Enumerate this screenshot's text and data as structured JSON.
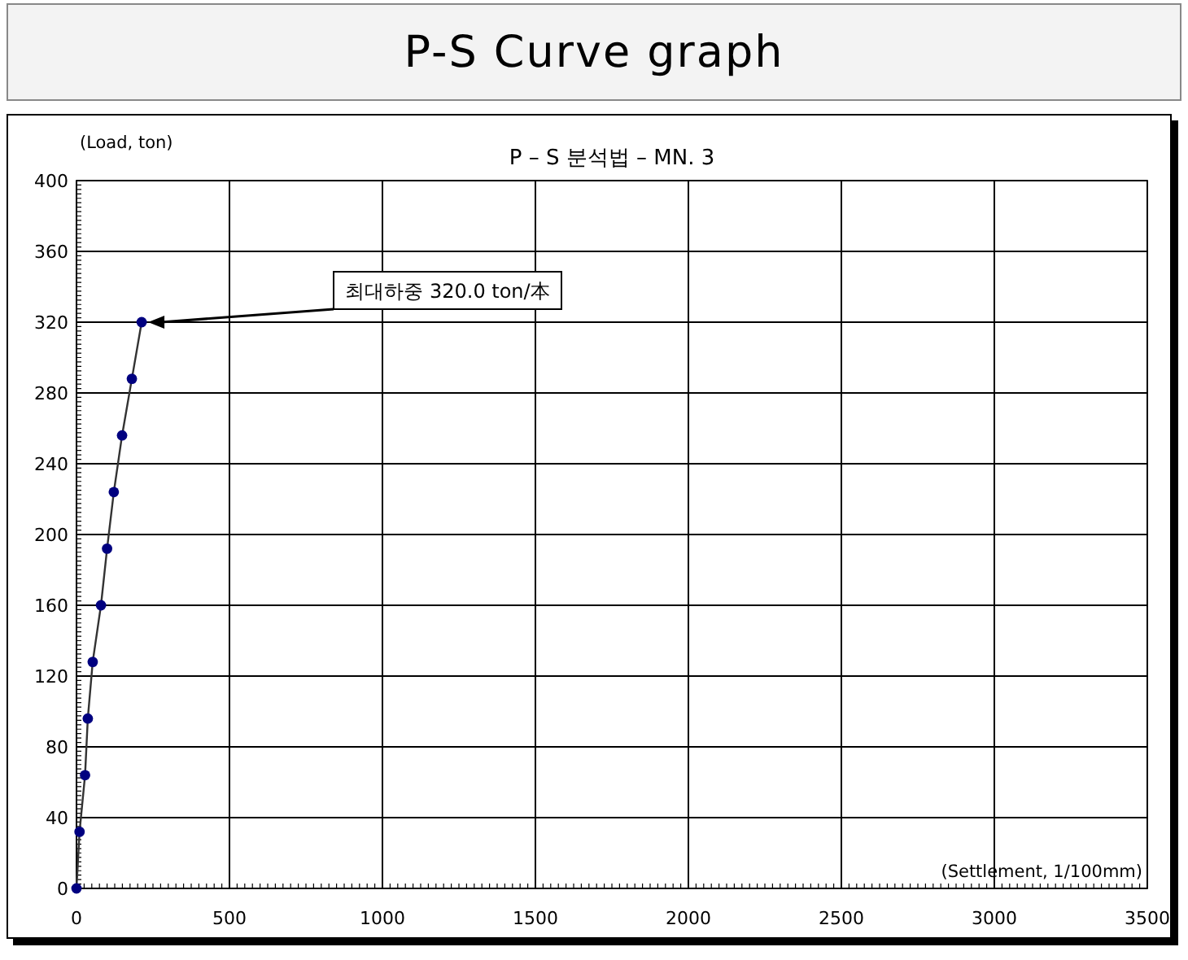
{
  "header": {
    "title": "P-S Curve graph"
  },
  "chart": {
    "chart_data": {
      "type": "line",
      "title": "P – S 분석법 – MN. 3",
      "xlabel": "(Settlement, 1/100mm)",
      "ylabel": "(Load, ton)",
      "x": [
        0,
        10,
        28,
        37,
        53,
        80,
        100,
        122,
        149,
        181,
        213
      ],
      "grid": true,
      "series": [
        {
          "color": "#000080",
          "marker": "circle",
          "values": [
            0,
            32,
            64,
            96,
            128,
            160,
            192,
            224,
            256,
            288,
            320
          ]
        }
      ],
      "xlim": [
        0,
        3500
      ],
      "ylim": [
        0,
        400
      ],
      "xticks": [
        0,
        500,
        1000,
        1500,
        2000,
        2500,
        3000,
        3500
      ],
      "yticks": [
        0,
        40,
        80,
        120,
        160,
        200,
        240,
        280,
        320,
        360,
        400
      ],
      "annotations": [
        "최대하중 320.0 ton/本"
      ]
    }
  }
}
